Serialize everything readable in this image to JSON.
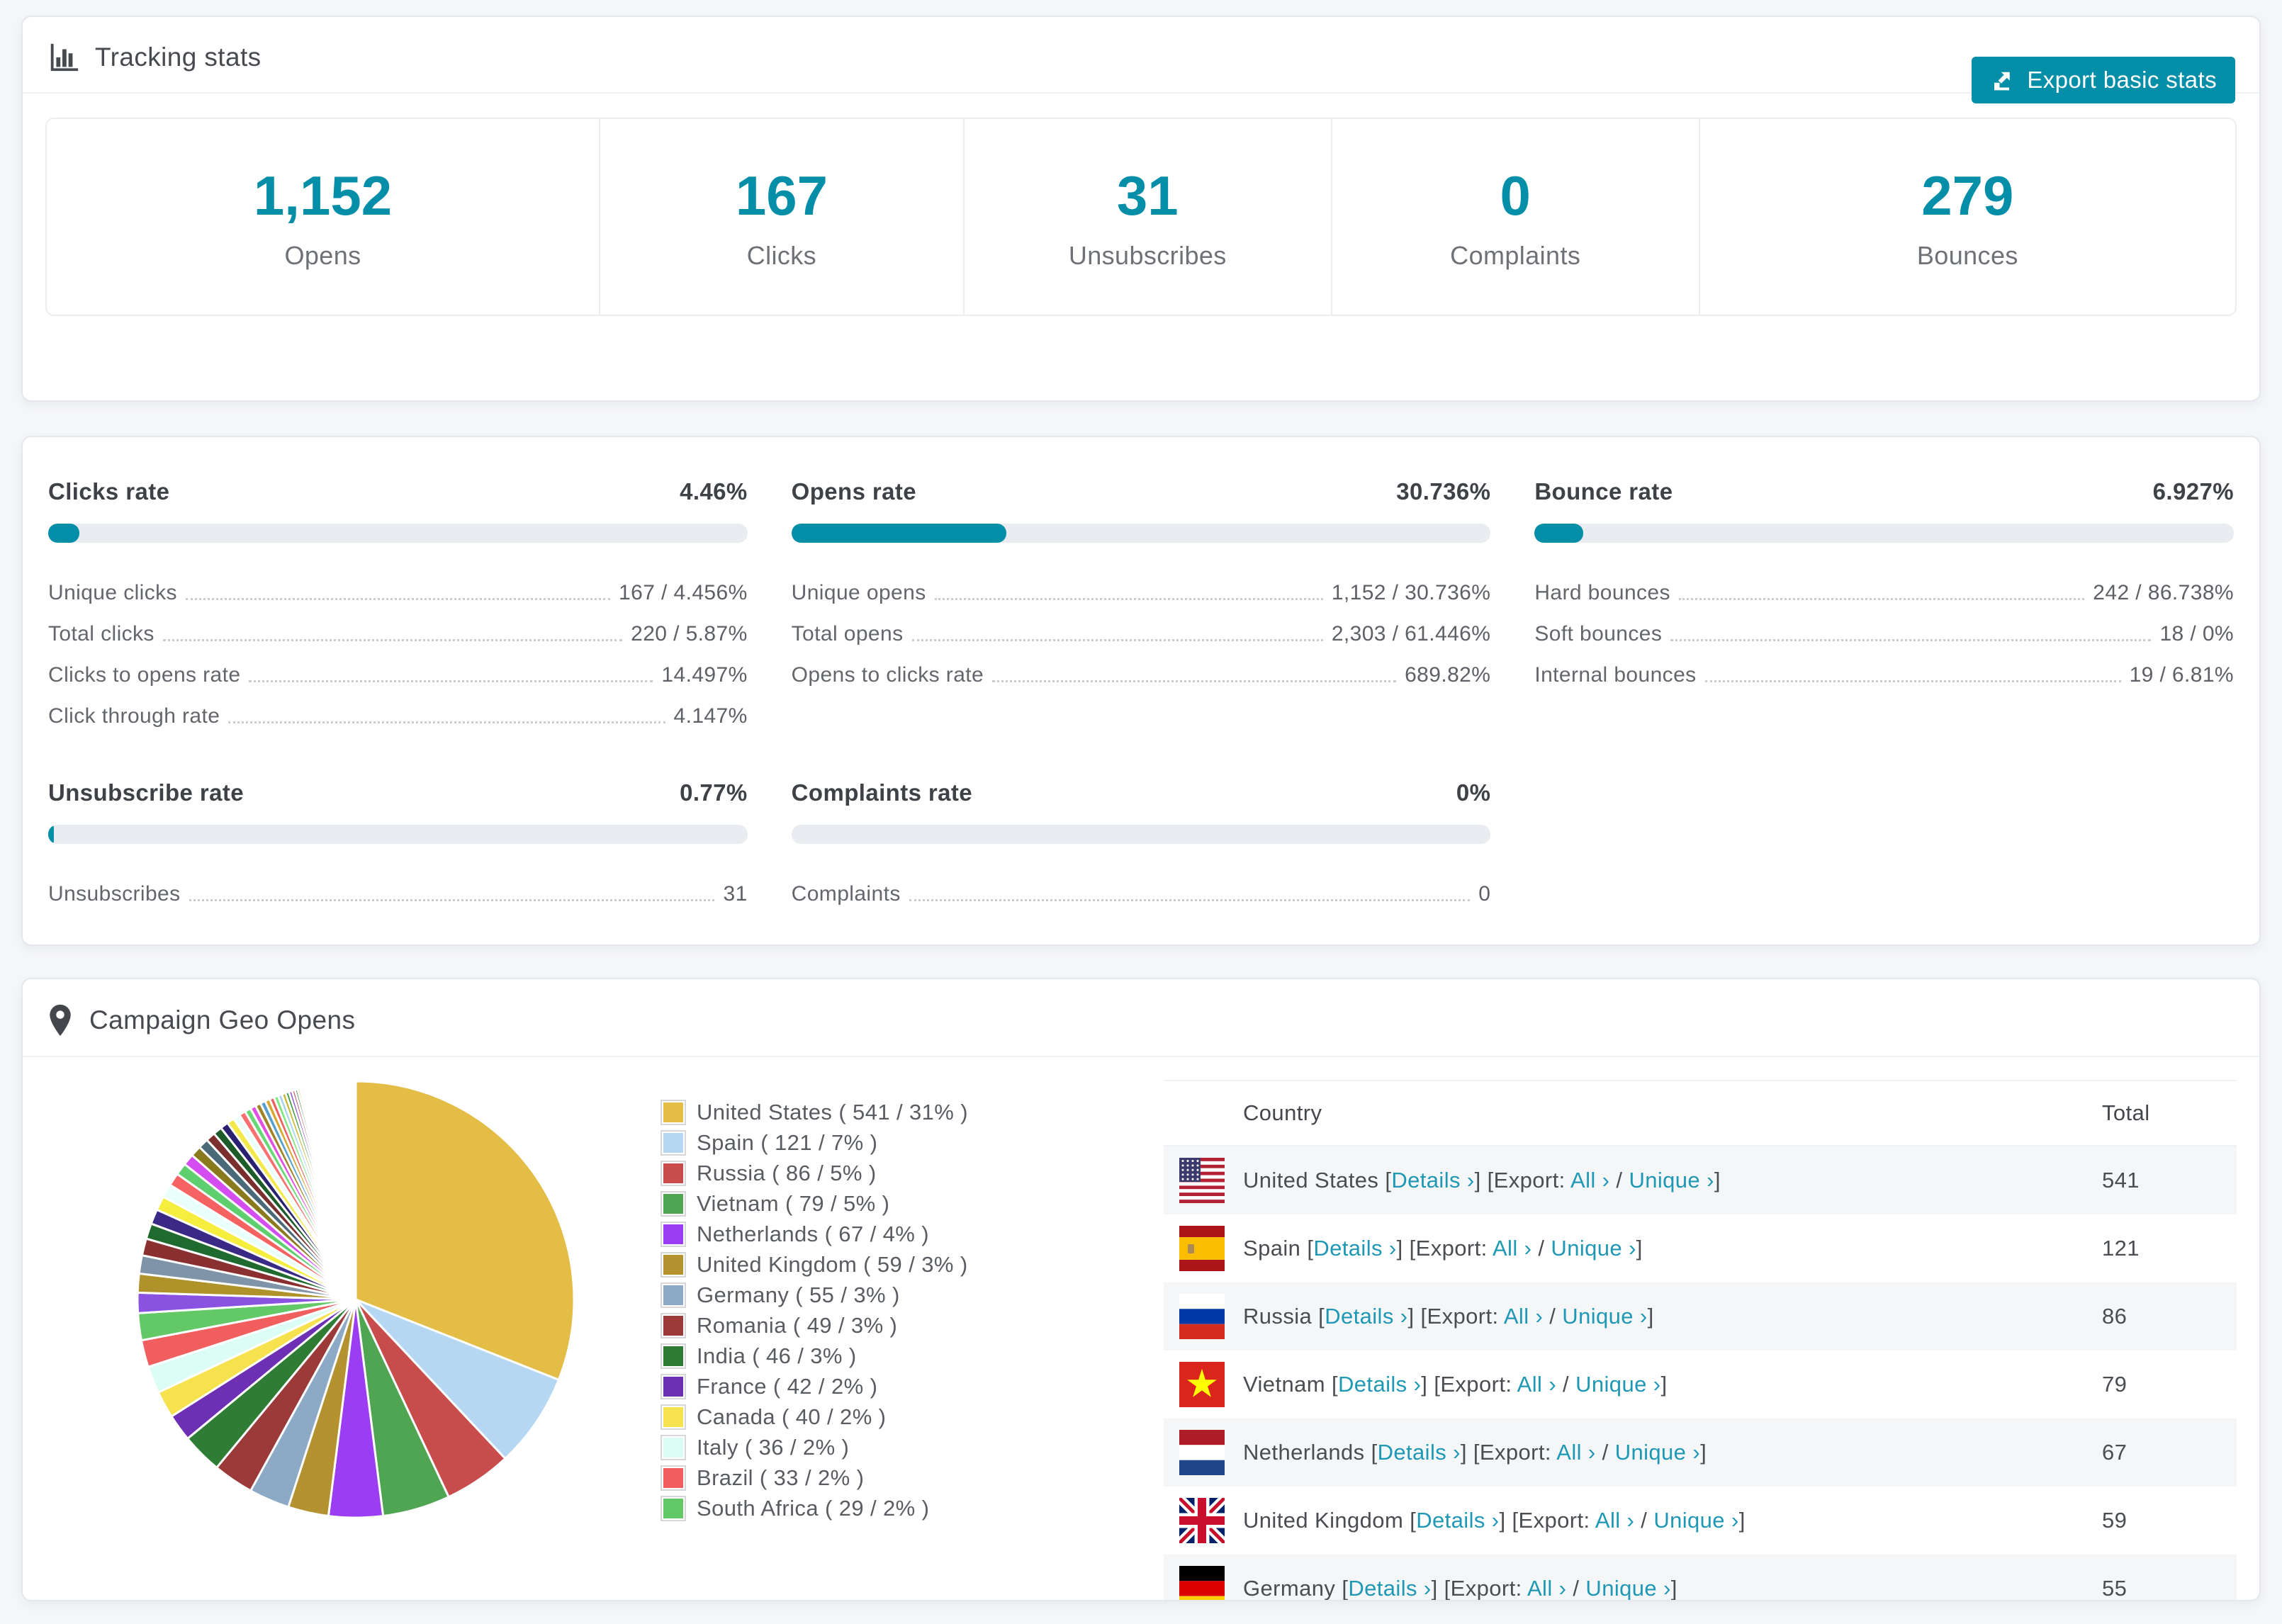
{
  "colors": {
    "accent": "#058ea8",
    "link": "#1e98b4",
    "bar_track": "#e9ecf0",
    "page_background": "#f5f6f8"
  },
  "tracking": {
    "title": "Tracking stats",
    "export_button": "Export basic stats",
    "stats": [
      {
        "value": "1,152",
        "label": "Opens"
      },
      {
        "value": "167",
        "label": "Clicks"
      },
      {
        "value": "31",
        "label": "Unsubscribes"
      },
      {
        "value": "0",
        "label": "Complaints"
      },
      {
        "value": "279",
        "label": "Bounces"
      }
    ]
  },
  "rates": [
    {
      "title": "Clicks rate",
      "value": "4.46%",
      "percent": 4.46,
      "rows": [
        {
          "label": "Unique clicks",
          "value": "167 / 4.456%"
        },
        {
          "label": "Total clicks",
          "value": "220 / 5.87%"
        },
        {
          "label": "Clicks to opens rate",
          "value": "14.497%"
        },
        {
          "label": "Click through rate",
          "value": "4.147%"
        }
      ]
    },
    {
      "title": "Opens rate",
      "value": "30.736%",
      "percent": 30.736,
      "rows": [
        {
          "label": "Unique opens",
          "value": "1,152 / 30.736%"
        },
        {
          "label": "Total opens",
          "value": "2,303 / 61.446%"
        },
        {
          "label": "Opens to clicks rate",
          "value": "689.82%"
        }
      ]
    },
    {
      "title": "Bounce rate",
      "value": "6.927%",
      "percent": 6.927,
      "rows": [
        {
          "label": "Hard bounces",
          "value": "242 / 86.738%"
        },
        {
          "label": "Soft bounces",
          "value": "18 / 0%"
        },
        {
          "label": "Internal bounces",
          "value": "19 / 6.81%"
        }
      ]
    },
    {
      "title": "Unsubscribe rate",
      "value": "0.77%",
      "percent": 0.77,
      "rows": [
        {
          "label": "Unsubscribes",
          "value": "31"
        }
      ]
    },
    {
      "title": "Complaints rate",
      "value": "0%",
      "percent": 0,
      "rows": [
        {
          "label": "Complaints",
          "value": "0"
        }
      ]
    }
  ],
  "geo": {
    "title": "Campaign Geo Opens",
    "table": {
      "headers": [
        "Country",
        "Total"
      ],
      "details_label": "Details ›",
      "export_prefix": "Export:",
      "all_label": "All ›",
      "unique_label": "Unique ›",
      "rows": [
        {
          "flag": "us",
          "country": "United States",
          "total": "541"
        },
        {
          "flag": "es",
          "country": "Spain",
          "total": "121"
        },
        {
          "flag": "ru",
          "country": "Russia",
          "total": "86"
        },
        {
          "flag": "vn",
          "country": "Vietnam",
          "total": "79"
        },
        {
          "flag": "nl",
          "country": "Netherlands",
          "total": "67"
        },
        {
          "flag": "gb",
          "country": "United Kingdom",
          "total": "59"
        },
        {
          "flag": "de",
          "country": "Germany",
          "total": "55"
        }
      ]
    }
  },
  "chart_data": {
    "type": "pie",
    "title": "Campaign Geo Opens",
    "legend_position": "right",
    "start_angle_deg": -90,
    "direction": "clockwise",
    "slices": [
      {
        "label": "United States",
        "count": 541,
        "percent": 31,
        "color": "#e3bd45"
      },
      {
        "label": "Spain",
        "count": 121,
        "percent": 7,
        "color": "#b5d7f3"
      },
      {
        "label": "Russia",
        "count": 86,
        "percent": 5,
        "color": "#c84c4c"
      },
      {
        "label": "Vietnam",
        "count": 79,
        "percent": 5,
        "color": "#50a553"
      },
      {
        "label": "Netherlands",
        "count": 67,
        "percent": 4,
        "color": "#9b3df2"
      },
      {
        "label": "United Kingdom",
        "count": 59,
        "percent": 3,
        "color": "#b3922f"
      },
      {
        "label": "Germany",
        "count": 55,
        "percent": 3,
        "color": "#8caac6"
      },
      {
        "label": "Romania",
        "count": 49,
        "percent": 3,
        "color": "#9c3a3a"
      },
      {
        "label": "India",
        "count": 46,
        "percent": 3,
        "color": "#2f7c35"
      },
      {
        "label": "France",
        "count": 42,
        "percent": 2,
        "color": "#6d2fb4"
      },
      {
        "label": "Canada",
        "count": 40,
        "percent": 2,
        "color": "#f6e14e"
      },
      {
        "label": "Italy",
        "count": 36,
        "percent": 2,
        "color": "#dcfdf6"
      },
      {
        "label": "Brazil",
        "count": 33,
        "percent": 2,
        "color": "#f15e5e"
      },
      {
        "label": "South Africa",
        "count": 29,
        "percent": 2,
        "color": "#63c966"
      }
    ],
    "other_slices": [
      {
        "percent": 1.5,
        "color": "#8a52e0"
      },
      {
        "percent": 1.4,
        "color": "#b0922a"
      },
      {
        "percent": 1.35,
        "color": "#7f94a8"
      },
      {
        "percent": 1.25,
        "color": "#8a3030"
      },
      {
        "percent": 1.15,
        "color": "#1f6b2f"
      },
      {
        "percent": 1.1,
        "color": "#3a2a85"
      },
      {
        "percent": 1.05,
        "color": "#f5ee3f"
      },
      {
        "percent": 1.0,
        "color": "#e8fffb"
      },
      {
        "percent": 0.95,
        "color": "#f56262"
      },
      {
        "percent": 0.9,
        "color": "#5ecf6e"
      },
      {
        "percent": 0.85,
        "color": "#d44df0"
      },
      {
        "percent": 0.8,
        "color": "#8a7a1e"
      },
      {
        "percent": 0.75,
        "color": "#4a6a7a"
      },
      {
        "percent": 0.7,
        "color": "#7a2e2e"
      },
      {
        "percent": 0.65,
        "color": "#1d5c28"
      },
      {
        "percent": 0.6,
        "color": "#2a2270"
      },
      {
        "percent": 0.55,
        "color": "#f4e94a"
      },
      {
        "percent": 0.5,
        "color": "#eafffc"
      },
      {
        "percent": 0.48,
        "color": "#fa7070"
      },
      {
        "percent": 0.45,
        "color": "#66d973"
      },
      {
        "percent": 0.42,
        "color": "#e24fe2"
      },
      {
        "percent": 0.4,
        "color": "#a08326"
      },
      {
        "percent": 0.38,
        "color": "#55a0d0"
      },
      {
        "percent": 0.36,
        "color": "#d9a62e"
      },
      {
        "percent": 0.34,
        "color": "#f06060"
      },
      {
        "percent": 0.32,
        "color": "#7ae87a"
      },
      {
        "percent": 0.3,
        "color": "#a8d3f0"
      },
      {
        "percent": 0.28,
        "color": "#c2b52a"
      },
      {
        "percent": 0.26,
        "color": "#3f9a43"
      },
      {
        "percent": 0.24,
        "color": "#8a4fd6"
      },
      {
        "percent": 0.22,
        "color": "#c2506a"
      },
      {
        "percent": 0.2,
        "color": "#2f7c35"
      },
      {
        "percent": 0.18,
        "color": "#e3bd45"
      },
      {
        "percent": 0.17,
        "color": "#b5d7f3"
      },
      {
        "percent": 0.16,
        "color": "#c84c4c"
      },
      {
        "percent": 0.15,
        "color": "#50a553"
      },
      {
        "percent": 0.14,
        "color": "#9b3df2"
      },
      {
        "percent": 0.13,
        "color": "#8caac6"
      },
      {
        "percent": 0.12,
        "color": "#9c3a3a"
      },
      {
        "percent": 0.11,
        "color": "#6d2fb4"
      },
      {
        "percent": 0.1,
        "color": "#f6e14e"
      },
      {
        "percent": 0.09,
        "color": "#f15e5e"
      },
      {
        "percent": 0.08,
        "color": "#63c966"
      },
      {
        "percent": 0.07,
        "color": "#7a3fd1"
      },
      {
        "percent": 0.06,
        "color": "#b0922a"
      },
      {
        "percent": 0.05,
        "color": "#7f94a8"
      },
      {
        "percent": 0.04,
        "color": "#8a3030"
      }
    ],
    "legend_format": "Label ( count / percent% )"
  }
}
